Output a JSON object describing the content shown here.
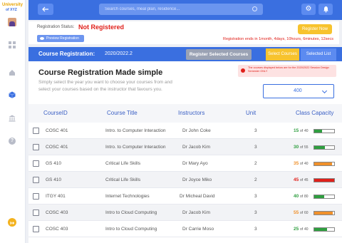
{
  "logo": {
    "line1": "University",
    "line2": "of XYZ"
  },
  "search": {
    "placeholder": "Search courses, meal plan, residence..."
  },
  "status": {
    "label": "Registration Status:",
    "value": "Not Registered",
    "preview_label": "Preview Registration",
    "register_now": "Register Now",
    "ends_text": "Registration ends in 1month, 4days, 10hours, 6minutes, 12secs"
  },
  "course_registration": {
    "title": "Course Registration:",
    "year": "2020/2022.2",
    "register_selected": "Register Selected Courses",
    "select_courses": "Select Courses",
    "selected_list": "Selected List",
    "intro_title": "Course Registration Made simple",
    "intro_text": "Simply select the year you want to choose your courses from and select your courses based on the instructor that favours you.",
    "warning": "The courses displayed below are for the 2020/2022 Session Design Semester ONLY",
    "year_select_value": "400"
  },
  "table": {
    "headers": [
      "CourseID",
      "Course Title",
      "Instructors",
      "Unit",
      "Class Capacity"
    ],
    "rows": [
      {
        "id": "COSC 401",
        "title": "Intro. to Computer Interaction",
        "instructor": "Dr John Coke",
        "unit": "3",
        "taken": "15",
        "total": "40",
        "ratio": 0.375,
        "color": "#2e9e3f"
      },
      {
        "id": "COSC 401",
        "title": "Intro. to Computer Interaction",
        "instructor": "Dr Jacob Kim",
        "unit": "3",
        "taken": "30",
        "total": "55",
        "ratio": 0.545,
        "color": "#2e9e3f"
      },
      {
        "id": "GS 410",
        "title": "Critical Life Skills",
        "instructor": "Dr Mary Ayo",
        "unit": "2",
        "taken": "35",
        "total": "40",
        "ratio": 0.875,
        "color": "#f0902a"
      },
      {
        "id": "GS 410",
        "title": "Critical Life Skills",
        "instructor": "Dr Joyce Miko",
        "unit": "2",
        "taken": "45",
        "total": "45",
        "ratio": 1.0,
        "color": "#e0201a"
      },
      {
        "id": "ITGY 401",
        "title": "Internet Technologies",
        "instructor": "Dr Micheal David",
        "unit": "3",
        "taken": "40",
        "total": "80",
        "ratio": 0.5,
        "color": "#2e9e3f"
      },
      {
        "id": "COSC 403",
        "title": "Intro to Cloud Computing",
        "instructor": "Dr Jacob Kim",
        "unit": "3",
        "taken": "55",
        "total": "60",
        "ratio": 0.917,
        "color": "#f0902a"
      },
      {
        "id": "COSC 403",
        "title": "Intro to Cloud Computing",
        "instructor": "Dr Carrie Moso",
        "unit": "3",
        "taken": "25",
        "total": "40",
        "ratio": 0.625,
        "color": "#2e9e3f"
      }
    ]
  },
  "colors": {
    "primary": "#3a6fe0",
    "accent": "#f7c32e",
    "danger": "#e0201a",
    "ok": "#2e9e3f",
    "warn": "#f0902a"
  },
  "icons": [
    "back-arrow-icon",
    "search-icon",
    "gear-icon",
    "bell-icon",
    "dashboard-icon",
    "home-icon",
    "cube-icon",
    "bank-icon",
    "help-icon",
    "logout-icon",
    "eye-icon",
    "alert-icon",
    "chevron-down-icon"
  ]
}
